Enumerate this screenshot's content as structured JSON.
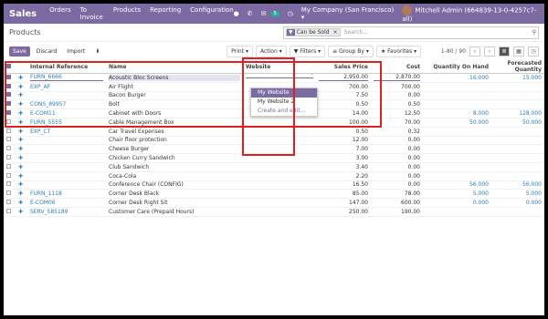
{
  "topbar": {
    "app_name": "Sales",
    "menu": [
      "Orders",
      "To Invoice",
      "Products",
      "Reporting",
      "Configuration"
    ],
    "badge": "5",
    "company": "My Company (San Francisco)",
    "user": "Mitchell Admin (664839-13-0-4257c7-all)"
  },
  "control": {
    "breadcrumb": "Products",
    "facet": "Can be Sold",
    "search_placeholder": "Search...",
    "save": "Save",
    "discard": "Discard",
    "import": "Import",
    "print": "Print",
    "action": "Action",
    "filters": "Filters",
    "group_by": "Group By",
    "favorites": "Favorites",
    "pager": "1-80 / 90"
  },
  "table": {
    "headers": [
      "Internal Reference",
      "Name",
      "Website",
      "Sales Price",
      "Cost",
      "Quantity On Hand",
      "Forecasted Quantity"
    ],
    "rows": [
      {
        "ref": "FURN_6666",
        "name": "Acoustic Bloc Screens",
        "website": "",
        "price": "2,950.00",
        "cost": "2,870.00",
        "qty": "16.000",
        "forecast": "15.000",
        "checked": true
      },
      {
        "ref": "EXP_AF",
        "name": "Air Flight",
        "website": "",
        "price": "700.00",
        "cost": "700.00",
        "qty": "",
        "forecast": "",
        "checked": true
      },
      {
        "ref": "",
        "name": "Bacon Burger",
        "website": "",
        "price": "7.50",
        "cost": "0.00",
        "qty": "",
        "forecast": "",
        "checked": true
      },
      {
        "ref": "CONS_89957",
        "name": "Bolt",
        "website": "",
        "price": "0.50",
        "cost": "0.50",
        "qty": "",
        "forecast": "",
        "checked": true
      },
      {
        "ref": "E-COM11",
        "name": "Cabinet with Doors",
        "website": "",
        "price": "14.00",
        "cost": "12.50",
        "qty": "8.000",
        "forecast": "128.000",
        "checked": true
      },
      {
        "ref": "FURN_5555",
        "name": "Cable Management Box",
        "website": "",
        "price": "100.00",
        "cost": "70.00",
        "qty": "50.000",
        "forecast": "50.000",
        "checked": false
      },
      {
        "ref": "EXP_CT",
        "name": "Car Travel Expenses",
        "website": "",
        "price": "0.50",
        "cost": "0.32",
        "qty": "",
        "forecast": "",
        "checked": false
      },
      {
        "ref": "",
        "name": "Chair floor protection",
        "website": "",
        "price": "12.00",
        "cost": "0.00",
        "qty": "",
        "forecast": "",
        "checked": false
      },
      {
        "ref": "",
        "name": "Cheese Burger",
        "website": "",
        "price": "7.00",
        "cost": "0.00",
        "qty": "",
        "forecast": "",
        "checked": false
      },
      {
        "ref": "",
        "name": "Chicken Curry Sandwich",
        "website": "",
        "price": "3.00",
        "cost": "0.00",
        "qty": "",
        "forecast": "",
        "checked": false
      },
      {
        "ref": "",
        "name": "Club Sandwich",
        "website": "",
        "price": "3.40",
        "cost": "0.00",
        "qty": "",
        "forecast": "",
        "checked": false
      },
      {
        "ref": "",
        "name": "Coca-Cola",
        "website": "",
        "price": "2.20",
        "cost": "0.00",
        "qty": "",
        "forecast": "",
        "checked": false
      },
      {
        "ref": "",
        "name": "Conference Chair (CONFIG)",
        "website": "",
        "price": "16.50",
        "cost": "0.00",
        "qty": "56.000",
        "forecast": "56.000",
        "checked": false
      },
      {
        "ref": "FURN_1118",
        "name": "Corner Desk Black",
        "website": "",
        "price": "85.00",
        "cost": "78.00",
        "qty": "5.000",
        "forecast": "5.000",
        "checked": false
      },
      {
        "ref": "E-COM06",
        "name": "Corner Desk Right Sit",
        "website": "",
        "price": "147.00",
        "cost": "600.00",
        "qty": "0.000",
        "forecast": "0.000",
        "checked": false
      },
      {
        "ref": "SERV_585189",
        "name": "Customer Care (Prepaid Hours)",
        "website": "",
        "price": "250.00",
        "cost": "190.00",
        "qty": "",
        "forecast": "",
        "checked": false
      }
    ]
  },
  "dropdown": {
    "options": [
      "My Website",
      "My Website 2"
    ],
    "create": "Create and edit..."
  },
  "colors": {
    "brand": "#7c6aa3",
    "link": "#2c7db8",
    "highlight_box": "#e02020"
  }
}
